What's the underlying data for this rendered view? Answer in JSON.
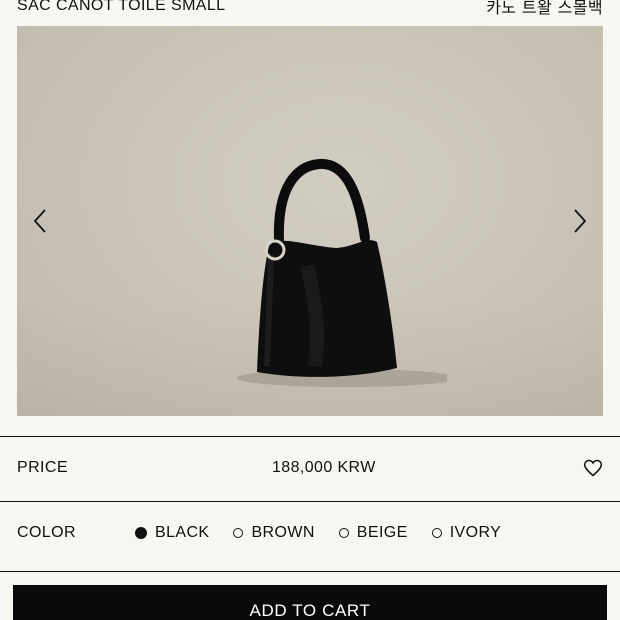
{
  "product": {
    "title": "SAC CANOT TOILE SMALL",
    "title_ko": "카노 트왈 스몰백"
  },
  "gallery": {
    "prev_icon": "chevron-left-icon",
    "next_icon": "chevron-right-icon"
  },
  "price": {
    "label": "PRICE",
    "value": "188,000 KRW",
    "wishlist_icon": "heart-icon"
  },
  "color": {
    "label": "COLOR",
    "options": [
      {
        "name": "BLACK",
        "selected": true
      },
      {
        "name": "BROWN",
        "selected": false
      },
      {
        "name": "BEIGE",
        "selected": false
      },
      {
        "name": "IVORY",
        "selected": false
      }
    ]
  },
  "cart": {
    "label": "ADD TO CART"
  },
  "colors": {
    "background": "#f8f6f1",
    "text": "#111111",
    "button": "#0a0a0a",
    "button_text": "#ffffff"
  }
}
